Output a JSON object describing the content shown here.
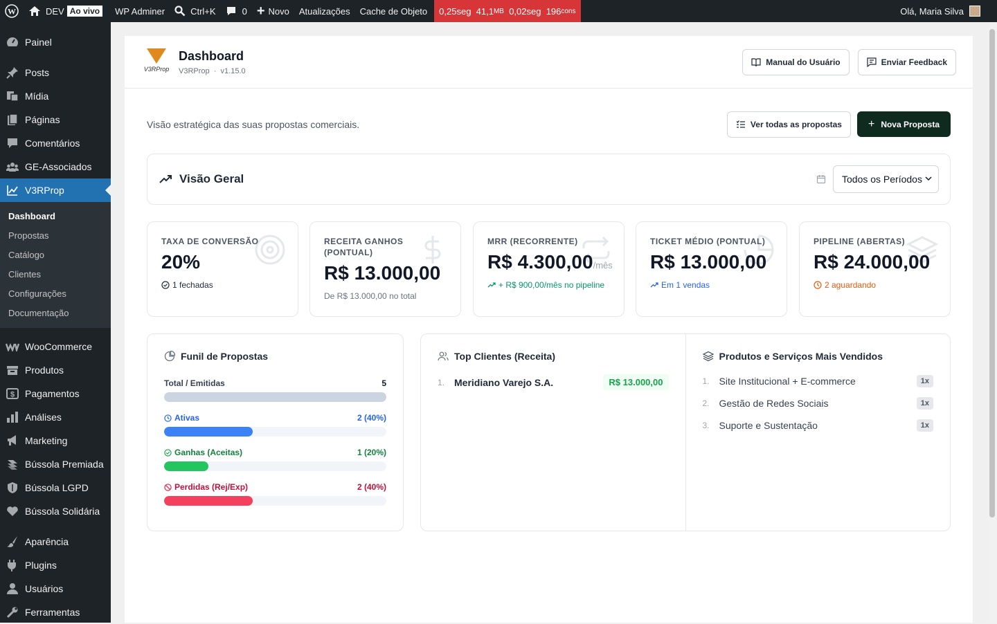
{
  "adminbar": {
    "site": "DEV",
    "live": "Ao vivo",
    "adminer": "WP Adminer",
    "search": "Ctrl+K",
    "comments": "0",
    "new": "Novo",
    "updates": "Atualizações",
    "cache": "Cache de Objeto",
    "perf": {
      "t1": "0,25seg",
      "mem": "41,1",
      "mem_unit": "MB",
      "t2": "0,02seg",
      "q": "196",
      "q_unit": "cons"
    },
    "greeting": "Olá, Maria Silva"
  },
  "sidebar": {
    "items": [
      {
        "label": "Painel"
      },
      {
        "label": "Posts"
      },
      {
        "label": "Mídia"
      },
      {
        "label": "Páginas"
      },
      {
        "label": "Comentários"
      },
      {
        "label": "GE-Associados"
      },
      {
        "label": "V3RProp"
      },
      {
        "label": "WooCommerce"
      },
      {
        "label": "Produtos"
      },
      {
        "label": "Pagamentos"
      },
      {
        "label": "Análises"
      },
      {
        "label": "Marketing"
      },
      {
        "label": "Bússola Premiada"
      },
      {
        "label": "Bússola LGPD"
      },
      {
        "label": "Bússola Solidária"
      },
      {
        "label": "Aparência"
      },
      {
        "label": "Plugins"
      },
      {
        "label": "Usuários"
      },
      {
        "label": "Ferramentas"
      }
    ],
    "submenu": [
      "Dashboard",
      "Propostas",
      "Catálogo",
      "Clientes",
      "Configurações",
      "Documentação"
    ]
  },
  "header": {
    "title": "Dashboard",
    "plugin": "V3RProp",
    "version": "v1.15.0",
    "logo_text": "V3RProp",
    "manual": "Manual do Usuário",
    "feedback": "Enviar Feedback"
  },
  "intro": {
    "text": "Visão estratégica das suas propostas comerciais.",
    "all": "Ver todas as propostas",
    "new": "Nova Proposta"
  },
  "overview": {
    "title": "Visão Geral",
    "period": "Todos os Períodos"
  },
  "kpis": [
    {
      "label": "TAXA DE CONVERSÃO",
      "value": "20%",
      "foot": "1 fechadas",
      "color": "#1f2937"
    },
    {
      "label": "RECEITA GANHOS (PONTUAL)",
      "value": "R$ 13.000,00",
      "foot": "De R$ 13.000,00 no total",
      "color": "#6b7280"
    },
    {
      "label": "MRR (RECORRENTE)",
      "value": "R$ 4.300,00",
      "suffix": "/mês",
      "foot": "+ R$ 900,00/mês no pipeline",
      "color": "#059669"
    },
    {
      "label": "TICKET MÉDIO (PONTUAL)",
      "value": "R$ 13.000,00",
      "foot": "Em 1 vendas",
      "color": "#2563eb"
    },
    {
      "label": "PIPELINE (ABERTAS)",
      "value": "R$ 24.000,00",
      "foot": "2 aguardando",
      "color": "#ea580c"
    }
  ],
  "funnel": {
    "title": "Funil de Propostas",
    "rows": [
      {
        "label": "Total / Emitidas",
        "count": "5",
        "pct": 1.0,
        "color": "#cbd5e1",
        "text": "#374151"
      },
      {
        "label": "Ativas",
        "count": "2 (40%)",
        "pct": 0.4,
        "color": "#3b82f6",
        "text": "#2563eb"
      },
      {
        "label": "Ganhas (Aceitas)",
        "count": "1 (20%)",
        "pct": 0.2,
        "color": "#22c55e",
        "text": "#15803d"
      },
      {
        "label": "Perdidas (Rej/Exp)",
        "count": "2 (40%)",
        "pct": 0.4,
        "color": "#f43f5e",
        "text": "#be123c"
      }
    ]
  },
  "top_clients": {
    "title": "Top Clientes (Receita)",
    "items": [
      {
        "n": "1.",
        "name": "Meridiano Varejo S.A.",
        "value": "R$ 13.000,00"
      }
    ]
  },
  "top_products": {
    "title": "Produtos e Serviços Mais Vendidos",
    "items": [
      {
        "n": "1.",
        "name": "Site Institucional + E-commerce",
        "qty": "1x"
      },
      {
        "n": "2.",
        "name": "Gestão de Redes Sociais",
        "qty": "1x"
      },
      {
        "n": "3.",
        "name": "Suporte e Sustentação",
        "qty": "1x"
      }
    ]
  }
}
